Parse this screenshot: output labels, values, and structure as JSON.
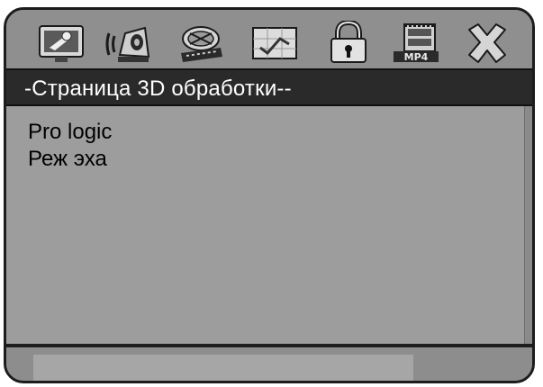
{
  "toolbar": {
    "icons": [
      {
        "name": "general-setup-icon"
      },
      {
        "name": "audio-setup-icon"
      },
      {
        "name": "video-setup-icon"
      },
      {
        "name": "preferences-icon"
      },
      {
        "name": "password-lock-icon"
      },
      {
        "name": "mp4-setup-icon"
      },
      {
        "name": "exit-icon"
      }
    ]
  },
  "page": {
    "title": "-Страница 3D обработки--"
  },
  "menu": {
    "options": [
      {
        "label": "Pro logic"
      },
      {
        "label": "Реж эха"
      }
    ]
  },
  "colors": {
    "title_bg": "#2a2a2a",
    "panel_bg": "#9d9d9d",
    "text": "#000000",
    "title_text": "#ffffff"
  }
}
